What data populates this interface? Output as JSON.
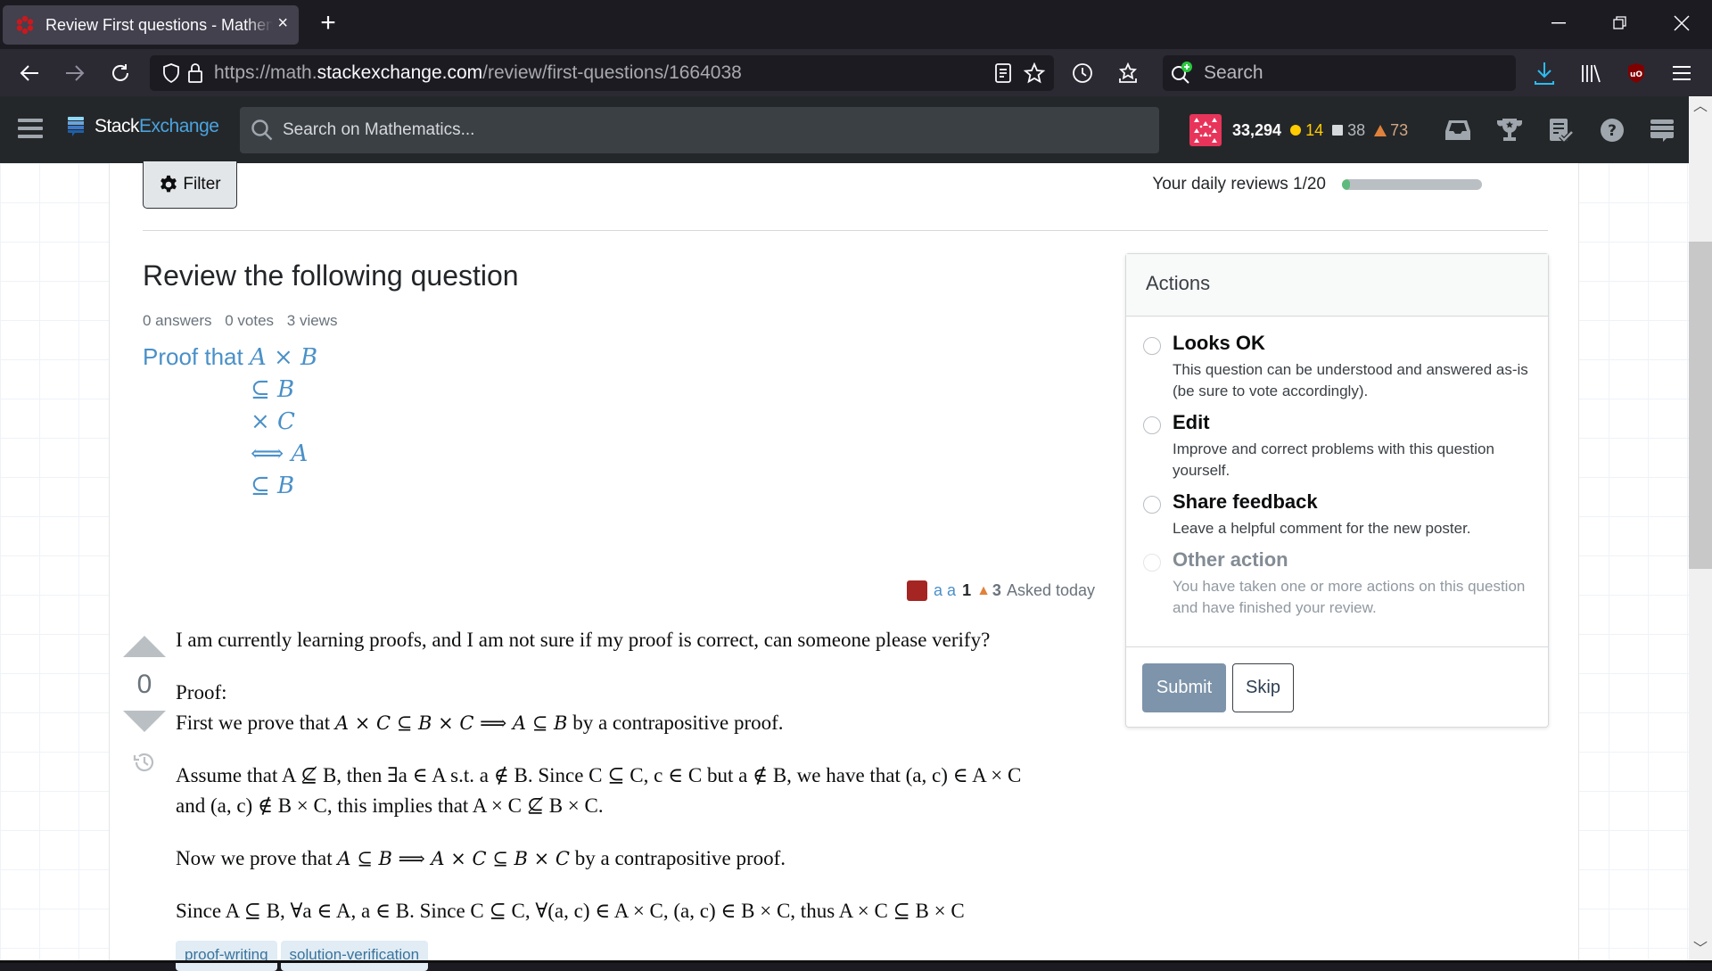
{
  "browser": {
    "tab_title": "Review First questions - Mathematics Stack Exchange",
    "tab_close": "×",
    "new_tab": "+",
    "url_prefix": "https://math.",
    "url_domain": "stackexchange.com",
    "url_path": "/review/first-questions/1664038",
    "search_placeholder": "Search",
    "window_controls": {
      "minimize": "—",
      "restore": "❐",
      "close": "✕"
    }
  },
  "topbar": {
    "logo_stack": "Stack",
    "logo_exchange": "Exchange",
    "search_placeholder": "Search on Mathematics...",
    "reputation": "33,294",
    "gold": "14",
    "silver": "38",
    "bronze": "73",
    "colors": {
      "gold": "#ffcc01",
      "silver": "#b4b8bc",
      "bronze": "#d1a684"
    }
  },
  "review": {
    "filter_label": "Filter",
    "daily_label": "Your daily reviews 1/20",
    "daily_progress": 0.05,
    "heading": "Review the following question",
    "stats": {
      "answers": "0 answers",
      "votes": "0 votes",
      "views": "3 views"
    },
    "title_lines": [
      "Proof that ",
      "A × B",
      "⊆ B",
      "× C",
      "⟺  A",
      "⊆ B"
    ],
    "owner": {
      "name": "a a",
      "rep": "1",
      "bronze": "3",
      "asked": "Asked today"
    },
    "vote_count": "0",
    "body": {
      "p1": "I am currently learning proofs, and I am not sure if my proof is correct, can someone please verify?",
      "p2a": "Proof:",
      "p2b_pre": "First we prove that ",
      "p2b_math": "A × C ⊆ B × C  ⟹  A ⊆ B",
      "p2b_post": " by a contrapositive proof.",
      "p3": "Assume that A ⊈ B, then ∃a ∈ A s.t. a ∉ B. Since C ⊆ C, c ∈ C but a ∉ B, we have that (a, c) ∈ A × C and (a, c) ∉ B × C, this implies that A × C ⊈ B × C.",
      "p4_pre": "Now we prove that ",
      "p4_math": "A ⊆ B  ⟹  A × C ⊆ B × C",
      "p4_post": " by a contrapositive proof.",
      "p5": "Since A ⊆ B, ∀a ∈ A, a ∈ B. Since C ⊆ C, ∀(a, c) ∈ A × C, (a, c) ∈ B × C, thus A × C ⊆ B × C"
    },
    "tags": [
      "proof-writing",
      "solution-verification"
    ],
    "actions": {
      "title": "Actions",
      "options": [
        {
          "label": "Looks OK",
          "desc": "This question can be understood and answered as-is (be sure to vote accordingly)."
        },
        {
          "label": "Edit",
          "desc": "Improve and correct problems with this question yourself."
        },
        {
          "label": "Share feedback",
          "desc": "Leave a helpful comment for the new poster."
        },
        {
          "label": "Other action",
          "desc": "You have taken one or more actions on this question and have finished your review."
        }
      ],
      "submit": "Submit",
      "skip": "Skip"
    }
  }
}
